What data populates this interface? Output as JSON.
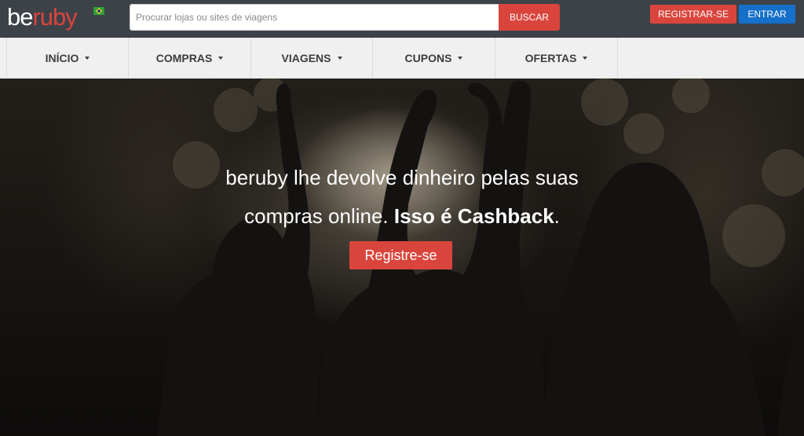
{
  "logo": {
    "part1": "be",
    "part2": "ruby",
    "flag_icon": "brazil-flag-icon"
  },
  "search": {
    "placeholder": "Procurar lojas ou sites de viagens",
    "value": "",
    "button_label": "BUSCAR"
  },
  "auth": {
    "register_label": "REGISTRAR-SE",
    "login_label": "ENTRAR"
  },
  "nav": {
    "items": [
      {
        "label": "INÍCIO"
      },
      {
        "label": "COMPRAS"
      },
      {
        "label": "VIAGENS"
      },
      {
        "label": "CUPONS"
      },
      {
        "label": "OFERTAS"
      }
    ]
  },
  "hero": {
    "line1": "beruby lhe devolve dinheiro pelas suas",
    "line2_start": "compras online. ",
    "line2_bold": "Isso é Cashback",
    "line2_end": ".",
    "button_label": "Registre-se"
  },
  "colors": {
    "accent": "#d9453d",
    "login": "#1570c9",
    "topbar": "#3d4249",
    "nav": "#f0f0f0"
  }
}
